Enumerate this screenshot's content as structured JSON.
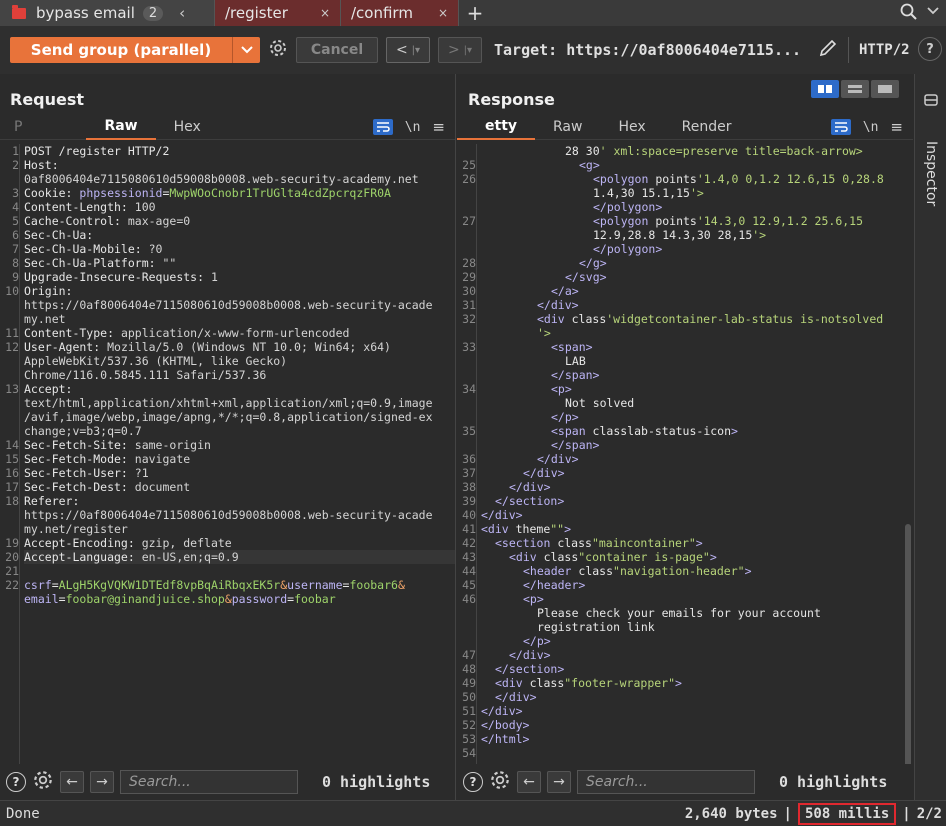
{
  "tabs": {
    "group_name": "bypass email",
    "group_count": "2",
    "tab1": "/register",
    "tab2": "/confirm",
    "close": "×",
    "add": "+",
    "prev": "‹"
  },
  "toolbar": {
    "send_label": "Send group (parallel)",
    "cancel_label": "Cancel",
    "prev": "<",
    "next": ">",
    "target": "Target: https://0af8006404e7115...",
    "http": "HTTP/2",
    "help": "?"
  },
  "request": {
    "title": "Request",
    "tab_faded": "P",
    "tab_raw": "Raw",
    "tab_hex": "Hex",
    "nl": "\\n",
    "lines": [
      {
        "n": "1",
        "t": "POST /register HTTP/2"
      },
      {
        "n": "2",
        "k": "Host:",
        "v": ""
      },
      {
        "n": "",
        "v": "0af8006404e7115080610d59008b0008.web-security-academy.net"
      },
      {
        "n": "3",
        "k": "Cookie: ",
        "a": "phpsessionid",
        "eq": "=",
        "g": "MwpWOoCnobr1TrUGlta4cdZpcrqzFR0A"
      },
      {
        "n": "4",
        "k": "Content-Length: ",
        "v": "100"
      },
      {
        "n": "5",
        "k": "Cache-Control: ",
        "v": "max-age=0"
      },
      {
        "n": "6",
        "k": "Sec-Ch-Ua:",
        "v": ""
      },
      {
        "n": "7",
        "k": "Sec-Ch-Ua-Mobile: ",
        "v": "?0"
      },
      {
        "n": "8",
        "k": "Sec-Ch-Ua-Platform: ",
        "v": "\"\""
      },
      {
        "n": "9",
        "k": "Upgrade-Insecure-Requests: ",
        "v": "1"
      },
      {
        "n": "10",
        "k": "Origin:",
        "v": ""
      },
      {
        "n": "",
        "v": "https://0af8006404e7115080610d59008b0008.web-security-acade"
      },
      {
        "n": "",
        "v": "my.net"
      },
      {
        "n": "11",
        "k": "Content-Type: ",
        "v": "application/x-www-form-urlencoded"
      },
      {
        "n": "12",
        "k": "User-Agent: ",
        "v": "Mozilla/5.0 (Windows NT 10.0; Win64; x64)"
      },
      {
        "n": "",
        "v": "AppleWebKit/537.36 (KHTML, like Gecko)"
      },
      {
        "n": "",
        "v": "Chrome/116.0.5845.111 Safari/537.36"
      },
      {
        "n": "13",
        "k": "Accept:",
        "v": ""
      },
      {
        "n": "",
        "v": "text/html,application/xhtml+xml,application/xml;q=0.9,image"
      },
      {
        "n": "",
        "v": "/avif,image/webp,image/apng,*/*;q=0.8,application/signed-ex"
      },
      {
        "n": "",
        "v": "change;v=b3;q=0.7"
      },
      {
        "n": "14",
        "k": "Sec-Fetch-Site: ",
        "v": "same-origin"
      },
      {
        "n": "15",
        "k": "Sec-Fetch-Mode: ",
        "v": "navigate"
      },
      {
        "n": "16",
        "k": "Sec-Fetch-User: ",
        "v": "?1"
      },
      {
        "n": "17",
        "k": "Sec-Fetch-Dest: ",
        "v": "document"
      },
      {
        "n": "18",
        "k": "Referer:",
        "v": ""
      },
      {
        "n": "",
        "v": "https://0af8006404e7115080610d59008b0008.web-security-acade"
      },
      {
        "n": "",
        "v": "my.net/register"
      },
      {
        "n": "19",
        "k": "Accept-Encoding: ",
        "v": "gzip, deflate"
      },
      {
        "n": "20",
        "k": "Accept-Language: ",
        "v": "en-US,en;q=0.9",
        "hl": true
      },
      {
        "n": "21",
        "v": ""
      },
      {
        "n": "22",
        "a": "csrf",
        "eq": "=",
        "g": "ALgH5KgVQKW1DTEdf8vpBqAiRbqxEK5r",
        "amp": "&",
        "a2": "username",
        "eq2": "=",
        "g2": "foobar6",
        "amp2": "&"
      },
      {
        "n": "",
        "a": "email",
        "eq": "=",
        "g": "foobar@ginandjuice.shop",
        "amp": "&",
        "a2": "password",
        "eq2": "=",
        "g2": "foobar"
      }
    ],
    "search_placeholder": "Search...",
    "highlights": "0 highlights"
  },
  "response": {
    "title": "Response",
    "tab_faded": "etty",
    "tab_raw": "Raw",
    "tab_hex": "Hex",
    "tab_render": "Render",
    "nl": "\\n",
    "lines": [
      {
        "n": "",
        "i": 6,
        "t": "28 30' xml:space=preserve title=back-arrow>"
      },
      {
        "n": "25",
        "i": 7,
        "t": "<g>"
      },
      {
        "n": "26",
        "i": 8,
        "t": "<polygon points='1.4,0 0,1.2 12.6,15 0,28.8"
      },
      {
        "n": "",
        "i": 8,
        "t": "1.4,30 15.1,15'>"
      },
      {
        "n": "",
        "i": 8,
        "t": "</polygon>"
      },
      {
        "n": "27",
        "i": 8,
        "t": "<polygon points='14.3,0 12.9,1.2 25.6,15"
      },
      {
        "n": "",
        "i": 8,
        "t": "12.9,28.8 14.3,30 28,15'>"
      },
      {
        "n": "",
        "i": 8,
        "t": "</polygon>"
      },
      {
        "n": "28",
        "i": 7,
        "t": "</g>"
      },
      {
        "n": "29",
        "i": 6,
        "t": "</svg>"
      },
      {
        "n": "30",
        "i": 5,
        "t": "</a>"
      },
      {
        "n": "31",
        "i": 4,
        "t": "</div>"
      },
      {
        "n": "32",
        "i": 4,
        "t": "<div class='widgetcontainer-lab-status is-notsolved"
      },
      {
        "n": "",
        "i": 4,
        "t": "'>"
      },
      {
        "n": "33",
        "i": 5,
        "t": "<span>"
      },
      {
        "n": "",
        "i": 6,
        "t": "LAB"
      },
      {
        "n": "",
        "i": 5,
        "t": "</span>"
      },
      {
        "n": "34",
        "i": 5,
        "t": "<p>"
      },
      {
        "n": "",
        "i": 6,
        "t": "Not solved"
      },
      {
        "n": "",
        "i": 5,
        "t": "</p>"
      },
      {
        "n": "35",
        "i": 5,
        "t": "<span class=lab-status-icon>"
      },
      {
        "n": "",
        "i": 5,
        "t": "</span>"
      },
      {
        "n": "36",
        "i": 4,
        "t": "</div>"
      },
      {
        "n": "37",
        "i": 3,
        "t": "</div>"
      },
      {
        "n": "38",
        "i": 2,
        "t": "</div>"
      },
      {
        "n": "39",
        "i": 1,
        "t": "</section>"
      },
      {
        "n": "40",
        "i": 0,
        "t": "</div>"
      },
      {
        "n": "41",
        "i": 0,
        "t": "<div theme=\"\">"
      },
      {
        "n": "42",
        "i": 1,
        "t": "<section class=\"maincontainer\">"
      },
      {
        "n": "43",
        "i": 2,
        "t": "<div class=\"container is-page\">"
      },
      {
        "n": "44",
        "i": 3,
        "t": "<header class=\"navigation-header\">"
      },
      {
        "n": "45",
        "i": 3,
        "t": "</header>"
      },
      {
        "n": "46",
        "i": 3,
        "t": "<p>"
      },
      {
        "n": "",
        "i": 4,
        "t": "Please check your emails for your account"
      },
      {
        "n": "",
        "i": 4,
        "t": "registration link"
      },
      {
        "n": "",
        "i": 3,
        "t": "</p>"
      },
      {
        "n": "47",
        "i": 2,
        "t": "</div>"
      },
      {
        "n": "48",
        "i": 1,
        "t": "</section>"
      },
      {
        "n": "49",
        "i": 1,
        "t": "<div class=\"footer-wrapper\">"
      },
      {
        "n": "50",
        "i": 1,
        "t": "</div>"
      },
      {
        "n": "51",
        "i": 0,
        "t": "</div>"
      },
      {
        "n": "52",
        "i": 0,
        "t": "</body>"
      },
      {
        "n": "53",
        "i": 0,
        "t": "</html>"
      },
      {
        "n": "54",
        "i": 0,
        "t": ""
      }
    ],
    "search_placeholder": "Search...",
    "highlights": "0 highlights"
  },
  "inspector": {
    "label": "Inspector"
  },
  "status": {
    "done": "Done",
    "bytes": "2,640 bytes",
    "sep": "|",
    "millis": "508 millis",
    "pages": "2/2"
  },
  "colors": {
    "accent": "#e8733a",
    "tab_active": "#6b2d2d",
    "highlight_box": "#e0282f"
  }
}
